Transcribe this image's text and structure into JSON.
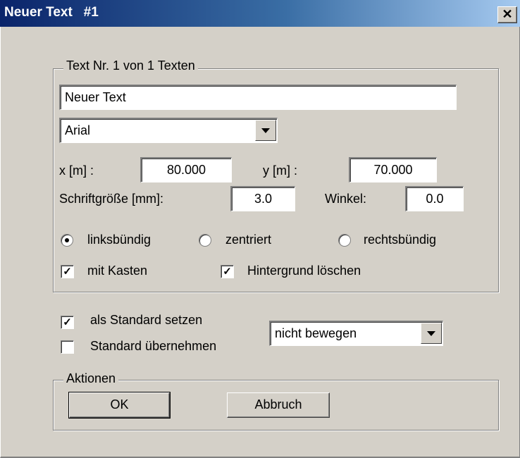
{
  "window": {
    "title": "Neuer Text   #1",
    "close_glyph": "✕"
  },
  "text_group": {
    "legend": "Text  Nr. 1 von 1 Texten",
    "text_value": "Neuer Text",
    "font_value": "Arial",
    "x_label": "x [m] :",
    "x_value": "80.000",
    "y_label": "y [m] :",
    "y_value": "70.000",
    "size_label": "Schriftgröße [mm]:",
    "size_value": "3.0",
    "angle_label": "Winkel:",
    "angle_value": "0.0",
    "align_left": "linksbündig",
    "align_center": "zentriert",
    "align_right": "rechtsbündig",
    "box_label": "mit Kasten",
    "clear_bg_label": "Hintergrund löschen",
    "check_glyph": "✓"
  },
  "defaults": {
    "set_default_label": "als Standard setzen",
    "use_default_label": "Standard übernehmen",
    "move_value": "nicht bewegen"
  },
  "actions": {
    "legend": "Aktionen",
    "ok_label": "OK",
    "cancel_label": "Abbruch"
  }
}
